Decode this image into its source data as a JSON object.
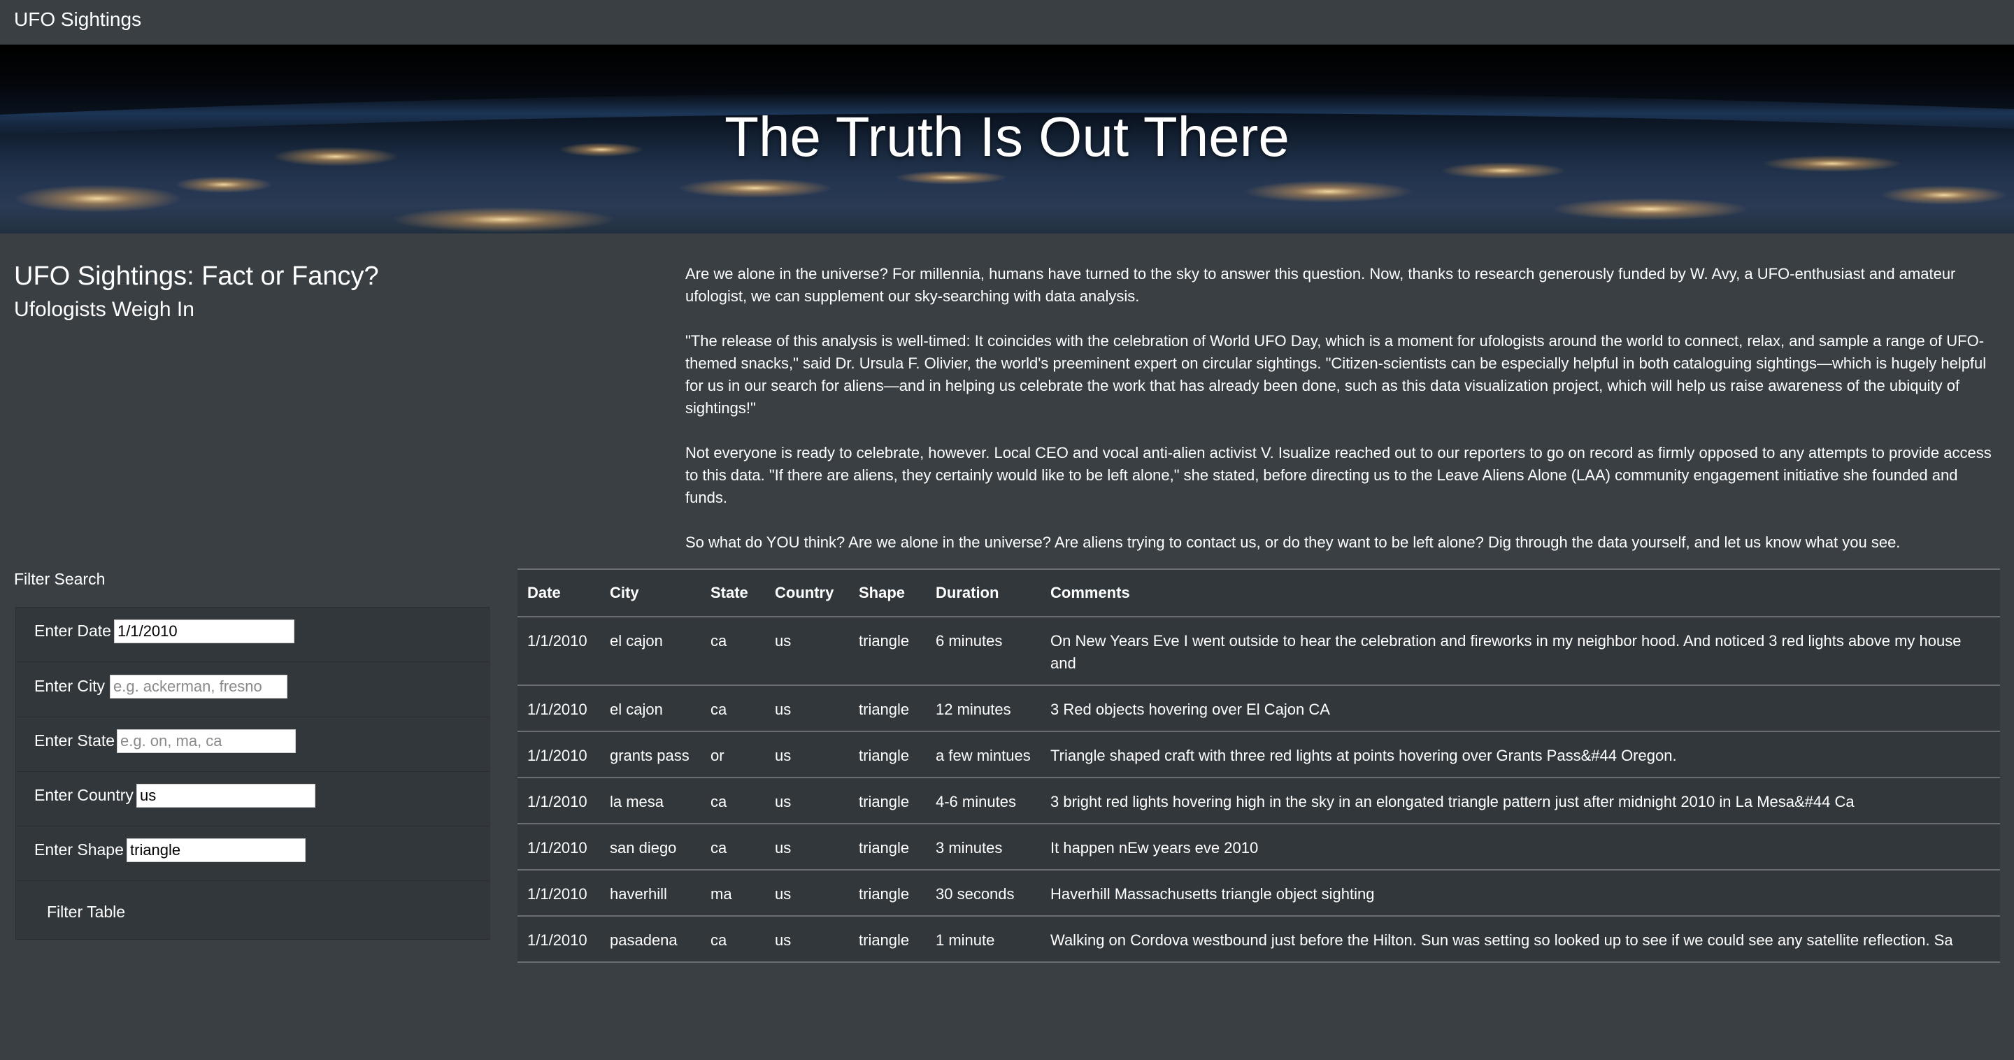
{
  "navbar": {
    "brand": "UFO Sightings"
  },
  "hero": {
    "title": "The Truth Is Out There"
  },
  "heading": {
    "title": "UFO Sightings: Fact or Fancy?",
    "subtitle": "Ufologists Weigh In"
  },
  "article": {
    "paragraphs": [
      "Are we alone in the universe? For millennia, humans have turned to the sky to answer this question. Now, thanks to research generously funded by W. Avy, a UFO-enthusiast and amateur ufologist, we can supplement our sky-searching with data analysis.",
      "\"The release of this analysis is well-timed: It coincides with the celebration of World UFO Day, which is a moment for ufologists around the world to connect, relax, and sample a range of UFO-themed snacks,\" said Dr. Ursula F. Olivier, the world's preeminent expert on circular sightings. \"Citizen-scientists can be especially helpful in both cataloguing sightings—which is hugely helpful for us in our search for aliens—and in helping us celebrate the work that has already been done, such as this data visualization project, which will help us raise awareness of the ubiquity of sightings!\"",
      "Not everyone is ready to celebrate, however. Local CEO and vocal anti-alien activist V. Isualize reached out to our reporters to go on record as firmly opposed to any attempts to provide access to this data. \"If there are aliens, they certainly would like to be left alone,\" she stated, before directing us to the Leave Aliens Alone (LAA) community engagement initiative she founded and funds.",
      "So what do YOU think? Are we alone in the universe? Are aliens trying to contact us, or do they want to be left alone? Dig through the data yourself, and let us know what you see."
    ]
  },
  "filter": {
    "heading": "Filter Search",
    "fields": [
      {
        "label": "Enter Date",
        "value": "1/1/2010",
        "placeholder": ""
      },
      {
        "label": "Enter City",
        "value": "",
        "placeholder": "e.g. ackerman, fresno"
      },
      {
        "label": "Enter State",
        "value": "",
        "placeholder": "e.g. on, ma, ca"
      },
      {
        "label": "Enter Country",
        "value": "us",
        "placeholder": ""
      },
      {
        "label": "Enter Shape",
        "value": "triangle",
        "placeholder": ""
      }
    ],
    "button_label": "Filter Table"
  },
  "table": {
    "headers": [
      "Date",
      "City",
      "State",
      "Country",
      "Shape",
      "Duration",
      "Comments"
    ],
    "rows": [
      [
        "1/1/2010",
        "el cajon",
        "ca",
        "us",
        "triangle",
        "6 minutes",
        "On New Years Eve I went outside to hear the celebration and fireworks in my neighbor hood. And noticed 3 red lights above my house and"
      ],
      [
        "1/1/2010",
        "el cajon",
        "ca",
        "us",
        "triangle",
        "12 minutes",
        "3 Red objects hovering over El Cajon CA"
      ],
      [
        "1/1/2010",
        "grants pass",
        "or",
        "us",
        "triangle",
        "a few mintues",
        "Triangle shaped craft with three red lights at points hovering over Grants Pass&#44 Oregon."
      ],
      [
        "1/1/2010",
        "la mesa",
        "ca",
        "us",
        "triangle",
        "4-6 minutes",
        "3 bright red lights hovering high in the sky in an elongated triangle pattern just after midnight 2010 in La Mesa&#44 Ca"
      ],
      [
        "1/1/2010",
        "san diego",
        "ca",
        "us",
        "triangle",
        "3 minutes",
        "It happen nEw years eve 2010"
      ],
      [
        "1/1/2010",
        "haverhill",
        "ma",
        "us",
        "triangle",
        "30 seconds",
        "Haverhill Massachusetts triangle object sighting"
      ],
      [
        "1/1/2010",
        "pasadena",
        "ca",
        "us",
        "triangle",
        "1 minute",
        "Walking on Cordova westbound just before the Hilton. Sun was setting so looked up to see if we could see any satellite reflection. Sa"
      ]
    ]
  },
  "colors": {
    "background": "#3a3f44",
    "panel": "#32373b",
    "border": "#6b6f73"
  }
}
